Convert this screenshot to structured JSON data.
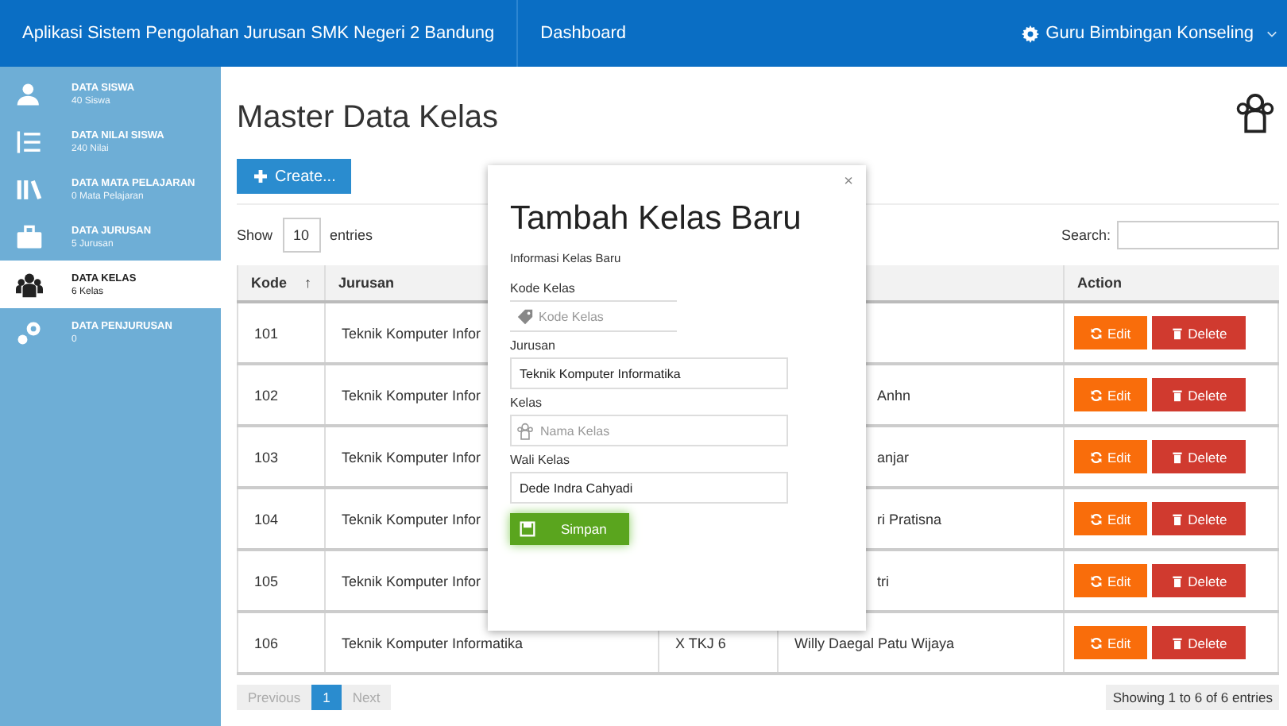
{
  "navbar": {
    "title": "Aplikasi Sistem Pengolahan Jurusan SMK Negeri 2 Bandung",
    "link": "Dashboard",
    "user": "Guru Bimbingan Konseling"
  },
  "sidebar": {
    "items": [
      {
        "title": "DATA SISWA",
        "subtitle": "40 Siswa",
        "selected": false
      },
      {
        "title": "DATA NILAI SISWA",
        "subtitle": "240 Nilai",
        "selected": false
      },
      {
        "title": "DATA MATA PELAJARAN",
        "subtitle": "0 Mata Pelajaran",
        "selected": false
      },
      {
        "title": "DATA JURUSAN",
        "subtitle": "5 Jurusan",
        "selected": false
      },
      {
        "title": "DATA KELAS",
        "subtitle": "6 Kelas",
        "selected": true
      },
      {
        "title": "DATA PENJURUSAN",
        "subtitle": "0",
        "selected": false
      }
    ]
  },
  "page": {
    "title": "Master Data Kelas",
    "create_button": "Create...",
    "show_label": "Show",
    "entries_value": "10",
    "entries_label": "entries",
    "search_label": "Search:"
  },
  "table": {
    "columns": [
      "Kode",
      "Jurusan",
      "",
      "",
      "Action"
    ],
    "sort_mark": "↑",
    "rows": [
      {
        "kode": "101",
        "jurusan": "Teknik Komputer Infor",
        "edit": "Edit",
        "delete": "Delete"
      },
      {
        "kode": "102",
        "jurusan": "Teknik Komputer Infor",
        "wali_kelas": "Anhn",
        "edit": "Edit",
        "delete": "Delete"
      },
      {
        "kode": "103",
        "jurusan": "Teknik Komputer Infor",
        "wali_kelas": "anjar",
        "edit": "Edit",
        "delete": "Delete"
      },
      {
        "kode": "104",
        "jurusan": "Teknik Komputer Infor",
        "wali_kelas": "ri Pratisna",
        "edit": "Edit",
        "delete": "Delete"
      },
      {
        "kode": "105",
        "jurusan": "Teknik Komputer Infor",
        "wali_kelas": "tri",
        "edit": "Edit",
        "delete": "Delete"
      },
      {
        "kode": "106",
        "jurusan": "Teknik Komputer Informatika",
        "kelas": "X TKJ 6",
        "wali_kelas": "Willy Daegal Patu Wijaya",
        "edit": "Edit",
        "delete": "Delete"
      }
    ]
  },
  "pagination": {
    "previous": "Previous",
    "pages": [
      {
        "label": "1",
        "selected": true
      }
    ],
    "next": "Next",
    "info": "Showing 1 to 6 of 6 entries"
  },
  "modal": {
    "close": "×",
    "title": "Tambah Kelas Baru",
    "subtitle": "Informasi Kelas Baru",
    "fields": [
      {
        "label": "Kode Kelas",
        "placeholder": "Kode Kelas"
      },
      {
        "label": "Jurusan",
        "value": "Teknik Komputer Informatika"
      },
      {
        "label": "Kelas",
        "placeholder": "Nama Kelas"
      },
      {
        "label": "Wali Kelas",
        "value": "Dede Indra Cahyadi"
      }
    ],
    "submit": "Simpan"
  }
}
